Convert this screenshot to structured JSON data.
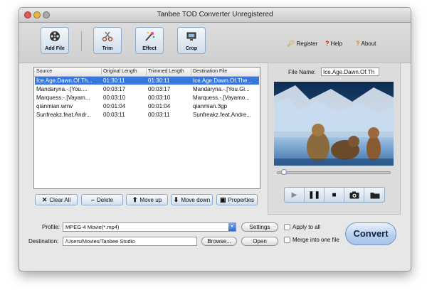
{
  "window": {
    "title": "Tanbee TOD Converter Unregistered"
  },
  "toolbar": {
    "buttons": [
      {
        "label": "Add File",
        "icon": "film-reel-icon"
      },
      {
        "label": "Trim",
        "icon": "scissors-icon"
      },
      {
        "label": "Effect",
        "icon": "magic-wand-icon"
      },
      {
        "label": "Crop",
        "icon": "crop-monitor-icon"
      }
    ],
    "links": [
      {
        "label": "Register",
        "icon": "key-icon"
      },
      {
        "label": "Help",
        "icon": "question-icon"
      },
      {
        "label": "About",
        "icon": "info-icon"
      }
    ]
  },
  "file_list": {
    "columns": [
      "Source",
      "Original Length",
      "Trimmed Length",
      "Destination File"
    ],
    "rows": [
      [
        "Ice.Age.Dawn.Of.Th...",
        "01:30:11",
        "01:30:11",
        "Ice.Age.Dawn.Of.The..."
      ],
      [
        "Mandaryna.-.[You....",
        "00:03:17",
        "00:03:17",
        "Mandaryna.-.[You.Gi..."
      ],
      [
        "Marquess.-.[Vayam...",
        "00:03:10",
        "00:03:10",
        "Marquess.-.[Vayamo..."
      ],
      [
        "qianmian.wmv",
        "00:01:04",
        "00:01:04",
        "qianmian.3gp"
      ],
      [
        "Sunfreakz.feat.Andr...",
        "00:03:11",
        "00:03:11",
        "Sunfreakz.feat.Andre..."
      ]
    ],
    "selected_row": 0
  },
  "actions": {
    "clear_all": "Clear All",
    "delete": "Delete",
    "move_up": "Move up",
    "move_down": "Move down",
    "properties": "Properties"
  },
  "preview": {
    "file_name_label": "File Name:",
    "file_name_value": "Ice.Age.Dawn.Of.Th",
    "seek_position": 0.04,
    "controls": [
      "play-icon",
      "pause-icon",
      "stop-icon",
      "camera-icon",
      "folder-icon"
    ]
  },
  "output": {
    "profile_label": "Profile:",
    "profile_value": "MPEG-4 Movie(*.mp4)",
    "settings_label": "Settings",
    "destination_label": "Destination:",
    "destination_value": "/Users/Movies/Tanbee Studio",
    "browse_label": "Browse...",
    "open_label": "Open",
    "apply_to_all": "Apply to all",
    "merge_label": "Merge into one file",
    "convert_label": "Convert"
  },
  "colors": {
    "selection": "#3876d9",
    "accent": "#2f6cd0"
  }
}
